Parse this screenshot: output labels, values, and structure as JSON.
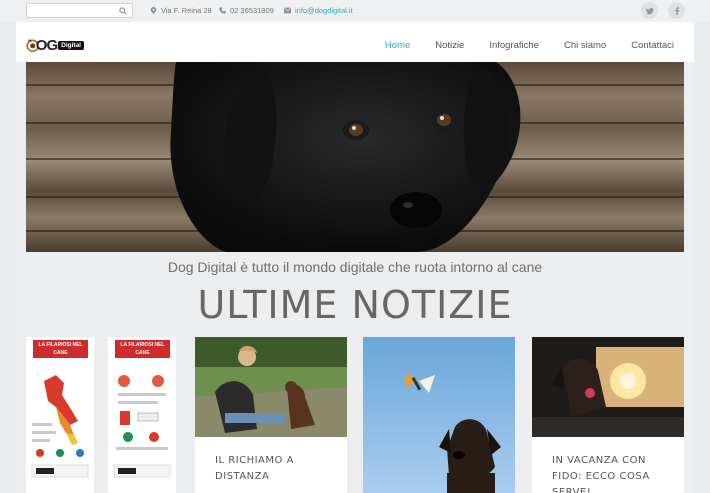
{
  "topbar": {
    "search_placeholder": "",
    "address": "Via F. Reina 28",
    "phone": "02 36531809",
    "email": "info@dogdigital.it",
    "social": [
      "twitter-icon",
      "facebook-icon"
    ]
  },
  "header": {
    "logo_text": "OG",
    "logo_badge": "Digital",
    "nav": [
      {
        "label": "Home",
        "active": true
      },
      {
        "label": "Notizie",
        "active": false
      },
      {
        "label": "Infografiche",
        "active": false
      },
      {
        "label": "Chi siamo",
        "active": false
      },
      {
        "label": "Contattaci",
        "active": false
      }
    ]
  },
  "hero": {
    "tagline": "Dog Digital è tutto il mondo digitale che ruota intorno al cane"
  },
  "section": {
    "title": "ULTIME NOTIZIE"
  },
  "cards": [
    {
      "infographic_headers": [
        "LA FILARIOSI NEL CANE",
        "LA FILARIOSI NEL CANE"
      ]
    },
    {
      "title": "IL RICHIAMO A DISTANZA"
    },
    {
      "title": ""
    },
    {
      "title": "IN VACANZA CON FIDO: ECCO COSA SERVE!"
    }
  ],
  "colors": {
    "accent": "#39a3c6",
    "infographic_red": "#cf2b2b",
    "page_bg": "#ecedee"
  }
}
